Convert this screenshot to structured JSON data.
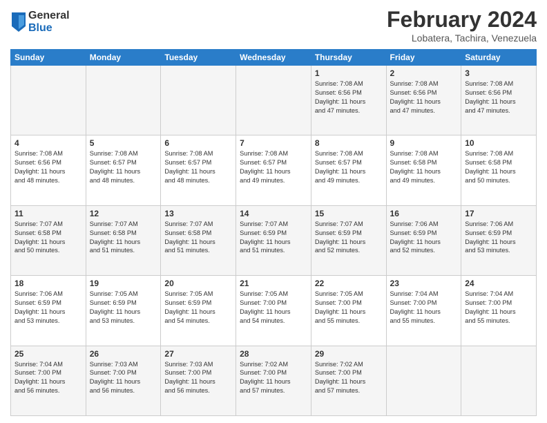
{
  "header": {
    "logo": {
      "general": "General",
      "blue": "Blue"
    },
    "title": "February 2024",
    "location": "Lobatera, Tachira, Venezuela"
  },
  "days_of_week": [
    "Sunday",
    "Monday",
    "Tuesday",
    "Wednesday",
    "Thursday",
    "Friday",
    "Saturday"
  ],
  "weeks": [
    [
      {
        "day": "",
        "info": ""
      },
      {
        "day": "",
        "info": ""
      },
      {
        "day": "",
        "info": ""
      },
      {
        "day": "",
        "info": ""
      },
      {
        "day": "1",
        "info": "Sunrise: 7:08 AM\nSunset: 6:56 PM\nDaylight: 11 hours\nand 47 minutes."
      },
      {
        "day": "2",
        "info": "Sunrise: 7:08 AM\nSunset: 6:56 PM\nDaylight: 11 hours\nand 47 minutes."
      },
      {
        "day": "3",
        "info": "Sunrise: 7:08 AM\nSunset: 6:56 PM\nDaylight: 11 hours\nand 47 minutes."
      }
    ],
    [
      {
        "day": "4",
        "info": "Sunrise: 7:08 AM\nSunset: 6:56 PM\nDaylight: 11 hours\nand 48 minutes."
      },
      {
        "day": "5",
        "info": "Sunrise: 7:08 AM\nSunset: 6:57 PM\nDaylight: 11 hours\nand 48 minutes."
      },
      {
        "day": "6",
        "info": "Sunrise: 7:08 AM\nSunset: 6:57 PM\nDaylight: 11 hours\nand 48 minutes."
      },
      {
        "day": "7",
        "info": "Sunrise: 7:08 AM\nSunset: 6:57 PM\nDaylight: 11 hours\nand 49 minutes."
      },
      {
        "day": "8",
        "info": "Sunrise: 7:08 AM\nSunset: 6:57 PM\nDaylight: 11 hours\nand 49 minutes."
      },
      {
        "day": "9",
        "info": "Sunrise: 7:08 AM\nSunset: 6:58 PM\nDaylight: 11 hours\nand 49 minutes."
      },
      {
        "day": "10",
        "info": "Sunrise: 7:08 AM\nSunset: 6:58 PM\nDaylight: 11 hours\nand 50 minutes."
      }
    ],
    [
      {
        "day": "11",
        "info": "Sunrise: 7:07 AM\nSunset: 6:58 PM\nDaylight: 11 hours\nand 50 minutes."
      },
      {
        "day": "12",
        "info": "Sunrise: 7:07 AM\nSunset: 6:58 PM\nDaylight: 11 hours\nand 51 minutes."
      },
      {
        "day": "13",
        "info": "Sunrise: 7:07 AM\nSunset: 6:58 PM\nDaylight: 11 hours\nand 51 minutes."
      },
      {
        "day": "14",
        "info": "Sunrise: 7:07 AM\nSunset: 6:59 PM\nDaylight: 11 hours\nand 51 minutes."
      },
      {
        "day": "15",
        "info": "Sunrise: 7:07 AM\nSunset: 6:59 PM\nDaylight: 11 hours\nand 52 minutes."
      },
      {
        "day": "16",
        "info": "Sunrise: 7:06 AM\nSunset: 6:59 PM\nDaylight: 11 hours\nand 52 minutes."
      },
      {
        "day": "17",
        "info": "Sunrise: 7:06 AM\nSunset: 6:59 PM\nDaylight: 11 hours\nand 53 minutes."
      }
    ],
    [
      {
        "day": "18",
        "info": "Sunrise: 7:06 AM\nSunset: 6:59 PM\nDaylight: 11 hours\nand 53 minutes."
      },
      {
        "day": "19",
        "info": "Sunrise: 7:05 AM\nSunset: 6:59 PM\nDaylight: 11 hours\nand 53 minutes."
      },
      {
        "day": "20",
        "info": "Sunrise: 7:05 AM\nSunset: 6:59 PM\nDaylight: 11 hours\nand 54 minutes."
      },
      {
        "day": "21",
        "info": "Sunrise: 7:05 AM\nSunset: 7:00 PM\nDaylight: 11 hours\nand 54 minutes."
      },
      {
        "day": "22",
        "info": "Sunrise: 7:05 AM\nSunset: 7:00 PM\nDaylight: 11 hours\nand 55 minutes."
      },
      {
        "day": "23",
        "info": "Sunrise: 7:04 AM\nSunset: 7:00 PM\nDaylight: 11 hours\nand 55 minutes."
      },
      {
        "day": "24",
        "info": "Sunrise: 7:04 AM\nSunset: 7:00 PM\nDaylight: 11 hours\nand 55 minutes."
      }
    ],
    [
      {
        "day": "25",
        "info": "Sunrise: 7:04 AM\nSunset: 7:00 PM\nDaylight: 11 hours\nand 56 minutes."
      },
      {
        "day": "26",
        "info": "Sunrise: 7:03 AM\nSunset: 7:00 PM\nDaylight: 11 hours\nand 56 minutes."
      },
      {
        "day": "27",
        "info": "Sunrise: 7:03 AM\nSunset: 7:00 PM\nDaylight: 11 hours\nand 56 minutes."
      },
      {
        "day": "28",
        "info": "Sunrise: 7:02 AM\nSunset: 7:00 PM\nDaylight: 11 hours\nand 57 minutes."
      },
      {
        "day": "29",
        "info": "Sunrise: 7:02 AM\nSunset: 7:00 PM\nDaylight: 11 hours\nand 57 minutes."
      },
      {
        "day": "",
        "info": ""
      },
      {
        "day": "",
        "info": ""
      }
    ]
  ]
}
